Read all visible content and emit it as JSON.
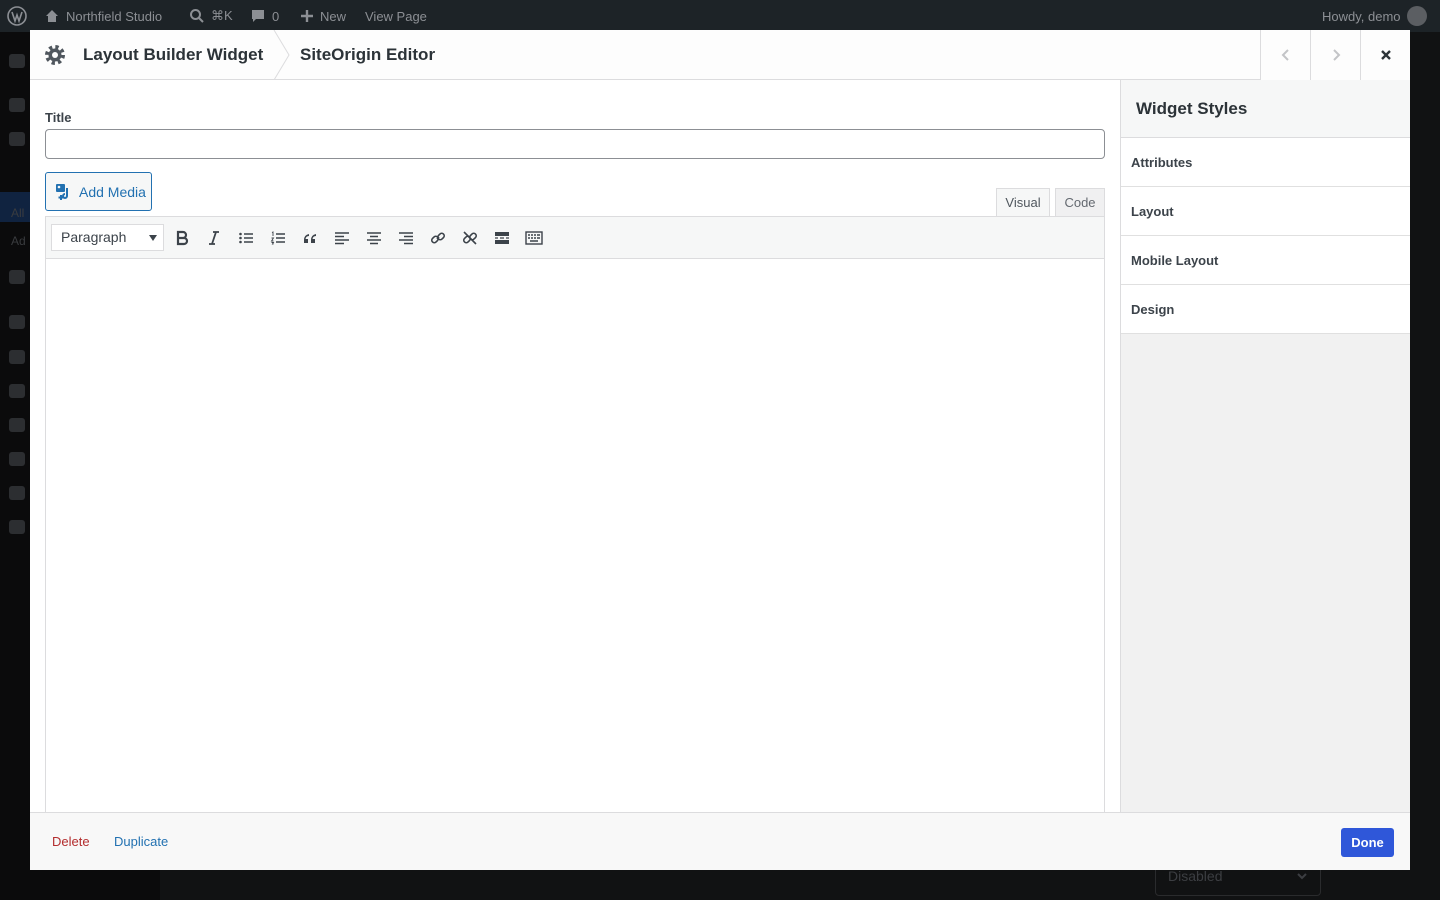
{
  "admin_bar": {
    "site_name": "Northfield Studio",
    "search_shortcut": "⌘K",
    "comments_count": "0",
    "new_label": "New",
    "view_page_label": "View Page",
    "greeting": "Howdy, demo"
  },
  "background_page": {
    "sidebar_text_1": "All",
    "sidebar_text_2": "Ad",
    "select_value": "Disabled"
  },
  "modal": {
    "title": "Layout Builder Widget",
    "subtitle": "SiteOrigin Editor",
    "prev_icon": "chevron-left-icon",
    "next_icon": "chevron-right-icon",
    "close_icon": "close-icon"
  },
  "form": {
    "title_label": "Title",
    "title_value": "",
    "add_media_label": "Add Media",
    "tab_visual": "Visual",
    "tab_code": "Code",
    "format_value": "Paragraph"
  },
  "toolbar_icons": [
    "bold-icon",
    "italic-icon",
    "bullet-list-icon",
    "numbered-list-icon",
    "blockquote-icon",
    "align-left-icon",
    "align-center-icon",
    "align-right-icon",
    "link-icon",
    "unlink-icon",
    "read-more-icon",
    "toolbar-toggle-icon"
  ],
  "sidebar": {
    "heading": "Widget Styles",
    "items": [
      {
        "label": "Attributes"
      },
      {
        "label": "Layout"
      },
      {
        "label": "Mobile Layout"
      },
      {
        "label": "Design"
      }
    ]
  },
  "footer": {
    "delete_label": "Delete",
    "duplicate_label": "Duplicate",
    "done_label": "Done"
  },
  "colors": {
    "primary": "#2f57d9",
    "link": "#2271b1",
    "danger": "#b32d2e"
  }
}
